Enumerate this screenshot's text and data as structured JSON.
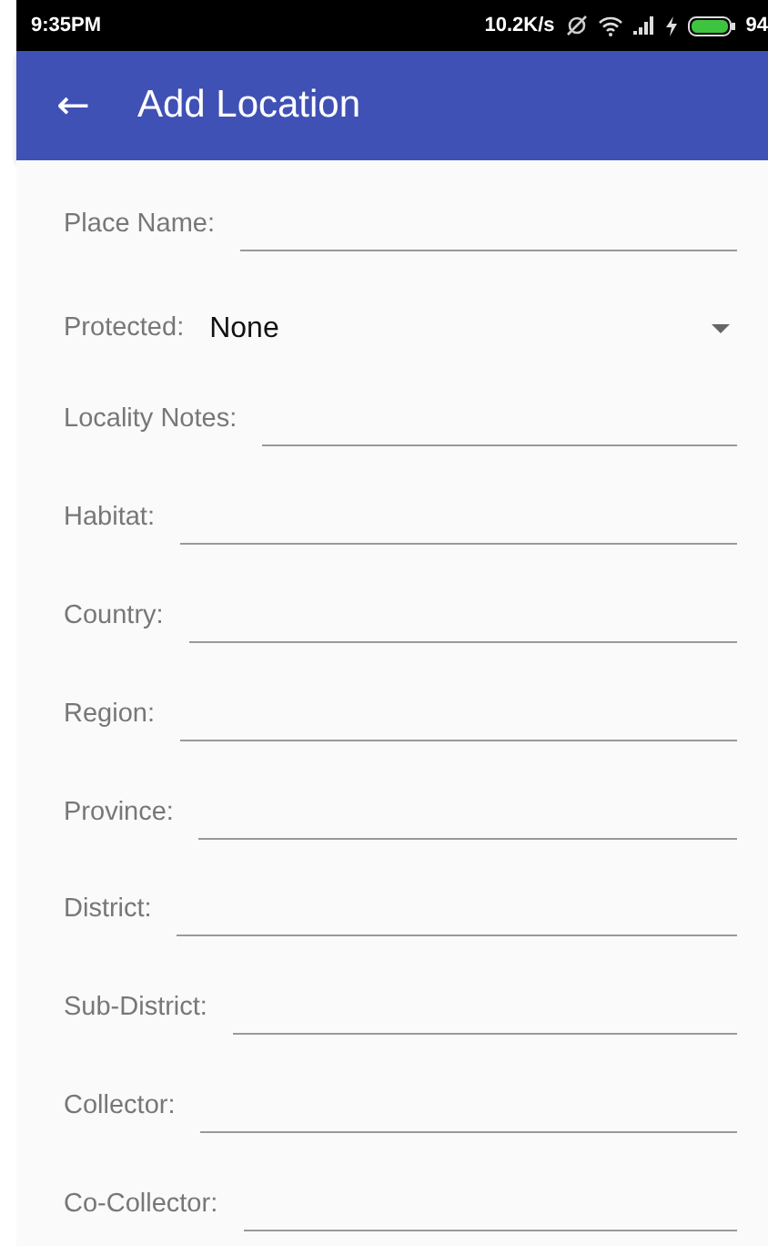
{
  "status_bar": {
    "time": "9:35PM",
    "speed": "10.2K/s",
    "battery": "94"
  },
  "app_bar": {
    "back": "←",
    "title": "Add Location"
  },
  "fields": [
    {
      "kind": "text",
      "label": "Place Name:"
    },
    {
      "kind": "dropdown",
      "label": "Protected:",
      "value": "None"
    },
    {
      "kind": "text",
      "label": "Locality Notes:"
    },
    {
      "kind": "text",
      "label": "Habitat:"
    },
    {
      "kind": "text",
      "label": "Country:"
    },
    {
      "kind": "text",
      "label": "Region:"
    },
    {
      "kind": "text",
      "label": "Province:"
    },
    {
      "kind": "text",
      "label": "District:"
    },
    {
      "kind": "text",
      "label": "Sub-District:"
    },
    {
      "kind": "text",
      "label": "Collector:"
    },
    {
      "kind": "text",
      "label": "Co-Collector:"
    }
  ]
}
